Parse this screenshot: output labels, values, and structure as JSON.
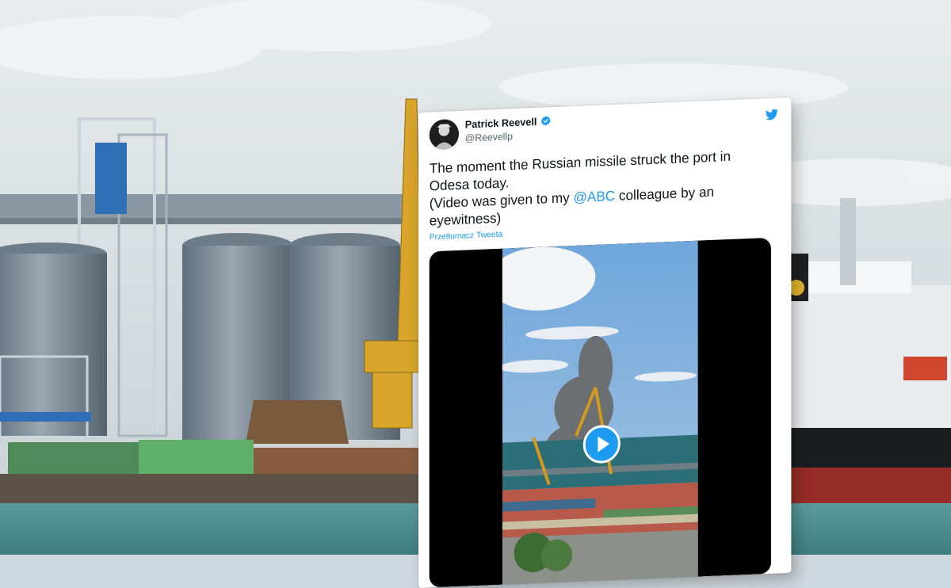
{
  "tweet": {
    "author_name": "Patrick Reevell",
    "author_handle": "@Reevellp",
    "text_lines": [
      "The moment the Russian missile struck the port in",
      "Odesa today.",
      "(Video was given to my ",
      " colleague by an",
      "eyewitness)"
    ],
    "mention": "@ABC",
    "translate_label": "Przetłumacz Tweeta"
  },
  "icons": {
    "verified": "verified-badge-icon",
    "twitter": "twitter-bird-icon",
    "play": "play-icon"
  },
  "colors": {
    "accent": "#1d9bf0",
    "text": "#0f1419",
    "muted": "#536471"
  }
}
